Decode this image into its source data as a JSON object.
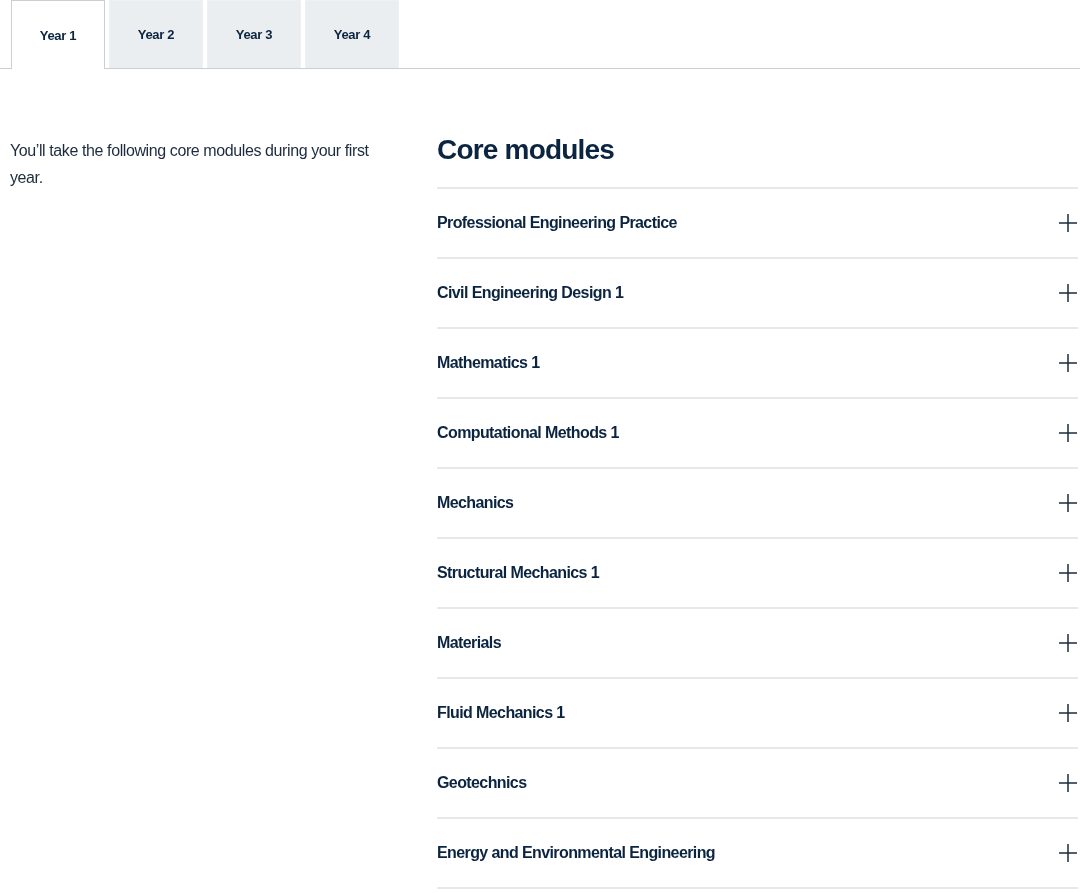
{
  "tabs": [
    {
      "label": "Year 1",
      "selected": true
    },
    {
      "label": "Year 2",
      "selected": false
    },
    {
      "label": "Year 3",
      "selected": false
    },
    {
      "label": "Year 4",
      "selected": false
    }
  ],
  "intro": "You’ll take the following core modules during your first year.",
  "core_modules": {
    "title": "Core modules",
    "items": [
      {
        "label": "Professional Engineering Practice",
        "expanded": false
      },
      {
        "label": "Civil Engineering Design 1",
        "expanded": false
      },
      {
        "label": "Mathematics 1",
        "expanded": false
      },
      {
        "label": "Computational Methods 1",
        "expanded": false
      },
      {
        "label": "Mechanics",
        "expanded": false
      },
      {
        "label": "Structural Mechanics 1",
        "expanded": false
      },
      {
        "label": "Materials",
        "expanded": false
      },
      {
        "label": "Fluid Mechanics 1",
        "expanded": false
      },
      {
        "label": "Geotechnics",
        "expanded": false
      },
      {
        "label": "Energy and Environmental Engineering",
        "expanded": false
      }
    ]
  }
}
